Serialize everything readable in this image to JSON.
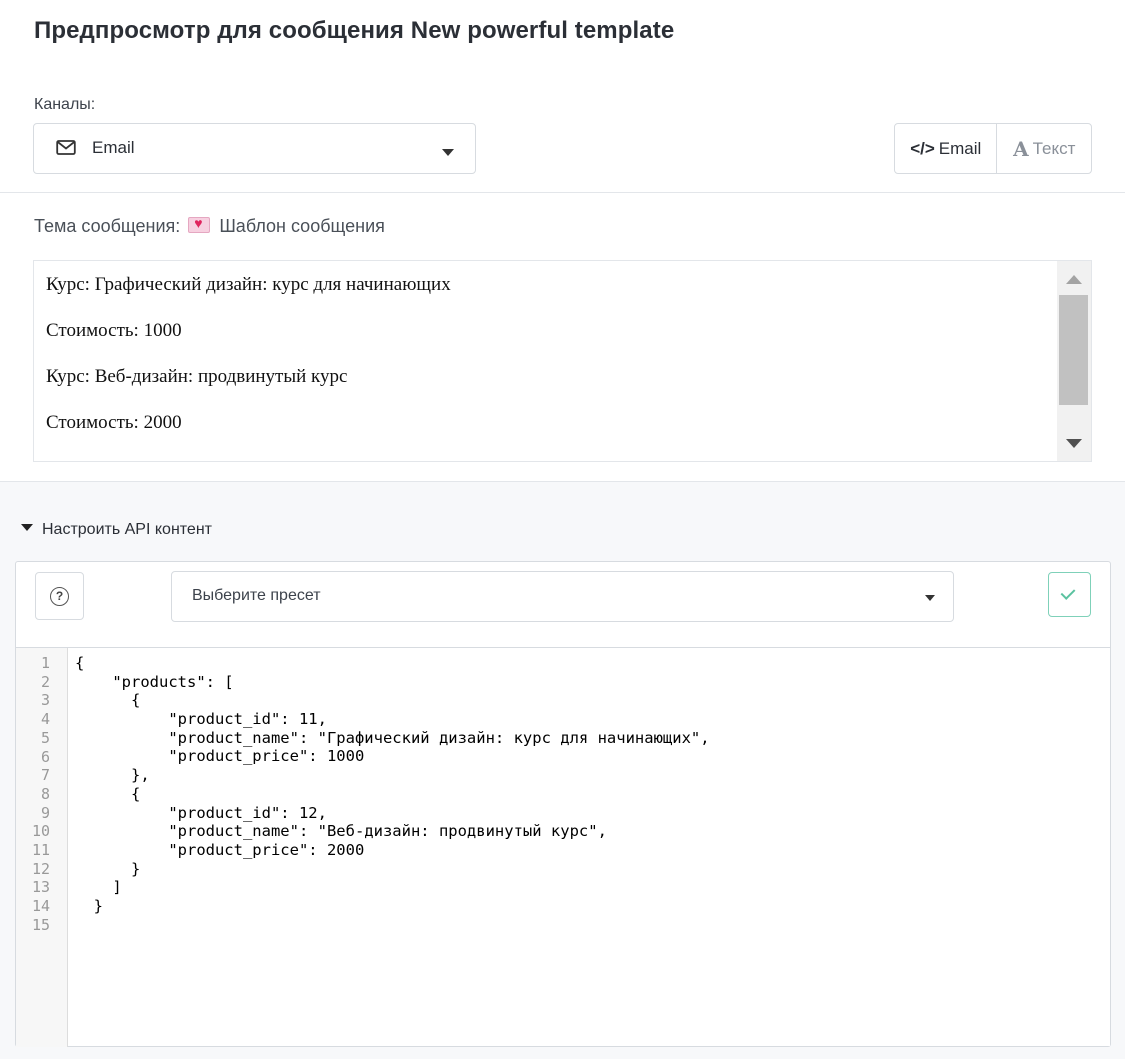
{
  "page": {
    "title": "Предпросмотр для сообщения New powerful template"
  },
  "channels": {
    "label": "Каналы:",
    "selected": "Email",
    "icon": "envelope-icon"
  },
  "view_toggle": {
    "email_label": "Email",
    "email_icon": "code-icon",
    "text_label": "Текст",
    "text_icon": "text-a-icon"
  },
  "subject": {
    "label": "Тема сообщения:",
    "emoji": "love-letter-emoji",
    "value": "Шаблон сообщения"
  },
  "preview": {
    "lines": [
      "Курс: Графический дизайн: курс для начинающих",
      "Стоимость: 1000",
      "Курс: Веб-дизайн: продвинутый курс",
      "Стоимость: 2000"
    ]
  },
  "api": {
    "toggle_label": "Настроить API контент",
    "preset_placeholder": "Выберите пресет",
    "help_icon": "question-circle-icon",
    "apply_icon": "check-icon",
    "accent_color": "#5bc2a0",
    "line_numbers": [
      "1",
      "2",
      "3",
      "4",
      "5",
      "6",
      "7",
      "8",
      "9",
      "10",
      "11",
      "12",
      "13",
      "14",
      "15"
    ],
    "code_lines": [
      "{",
      "    \"products\": [",
      "      {",
      "          \"product_id\": 11,",
      "          \"product_name\": \"Графический дизайн: курс для начинающих\",",
      "          \"product_price\": 1000",
      "      },",
      "      {",
      "          \"product_id\": 12,",
      "          \"product_name\": \"Веб-дизайн: продвинутый курс\",",
      "          \"product_price\": 2000",
      "      }",
      "    ]",
      "  }",
      ""
    ]
  }
}
